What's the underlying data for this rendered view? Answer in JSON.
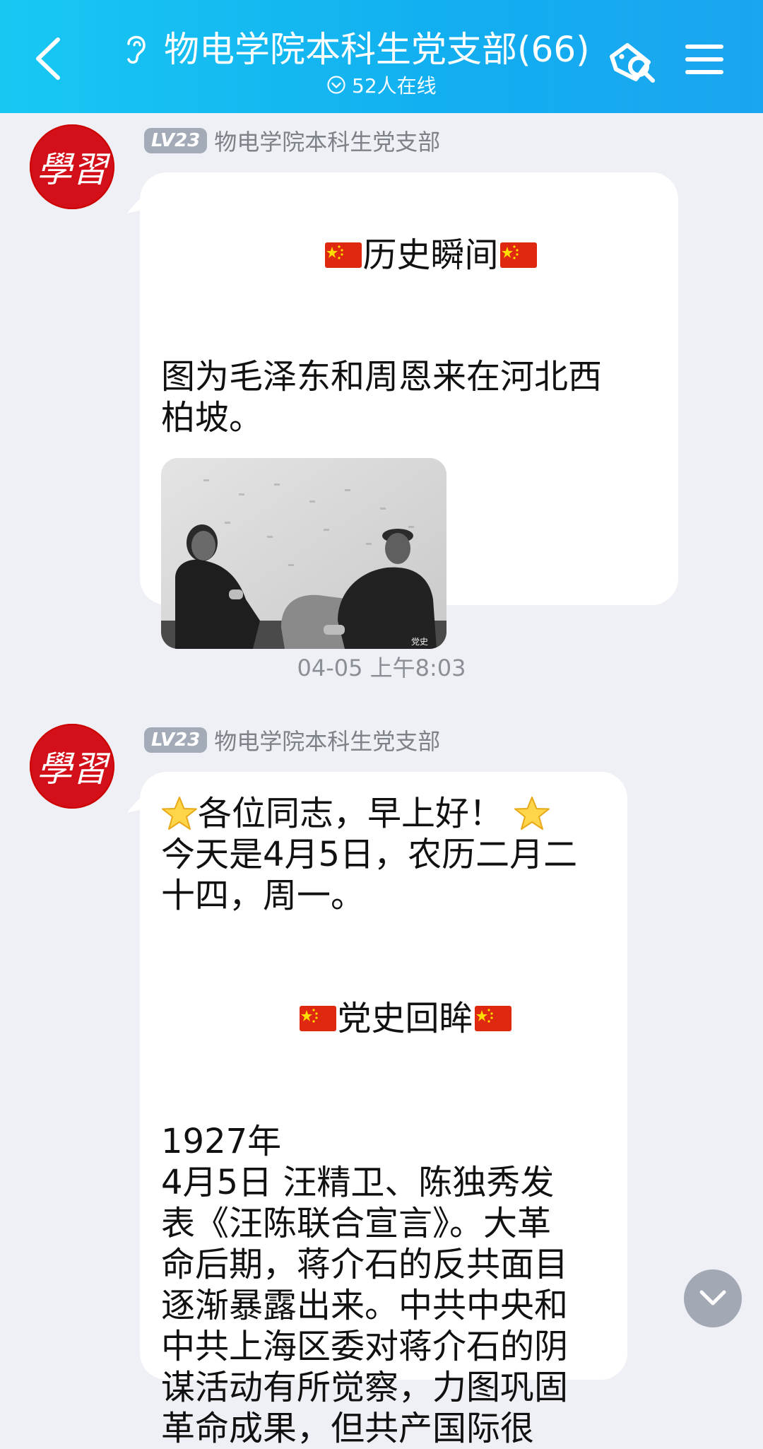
{
  "header": {
    "title": "物电学院本科生党支部(66)",
    "online": "52人在线"
  },
  "messages": [
    {
      "sender_level": "LV23",
      "sender_name": "物电学院本科生党支部",
      "avatar_text": "學習",
      "heading": "历史瞬间",
      "body": "图为毛泽东和周恩来在河北西\n柏坡。",
      "image_watermark": "党史",
      "image_alt": "毛泽东和周恩来在河北西柏坡的黑白照片"
    },
    {
      "sender_level": "LV23",
      "sender_name": "物电学院本科生党支部",
      "avatar_text": "學習",
      "greeting": "各位同志，早上好！",
      "date_line": "今天是4月5日，农历二月二\n十四，周一。",
      "heading": "党史回眸",
      "year": "1927年",
      "body": "4月5日 汪精卫、陈独秀发\n表《汪陈联合宣言》。大革\n命后期，蒋介石的反共面目\n逐渐暴露出来。中共中央和\n中共上海区委对蒋介石的阴\n谋活动有所觉察，力图巩固\n革命成果，但共产国际很"
    }
  ],
  "timestamp": "04-05 上午8:03",
  "colors": {
    "header_start": "#18c8f3",
    "header_end": "#1ba6ef",
    "background": "#eef0f5",
    "avatar_red": "#d3101a"
  },
  "icons": {
    "back": "chevron-left-icon",
    "ear": "ear-icon",
    "online": "check-circle-icon",
    "tag": "tag-icon",
    "menu": "menu-icon",
    "scroll": "chevron-down-icon"
  }
}
